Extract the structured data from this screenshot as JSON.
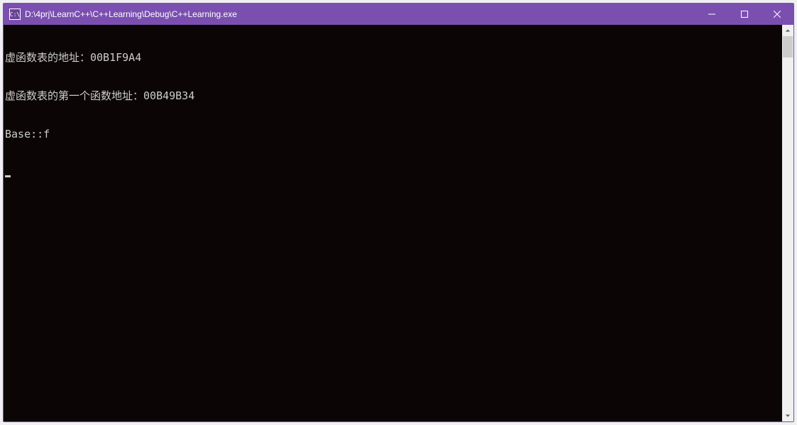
{
  "window": {
    "icon_label": "C:\\",
    "title": "D:\\4prj\\LearnC++\\C++Learning\\Debug\\C++Learning.exe"
  },
  "console": {
    "lines": [
      "虚函数表的地址：00B1F9A4",
      "虚函数表的第一个函数地址：00B49B34",
      "Base::f"
    ]
  }
}
